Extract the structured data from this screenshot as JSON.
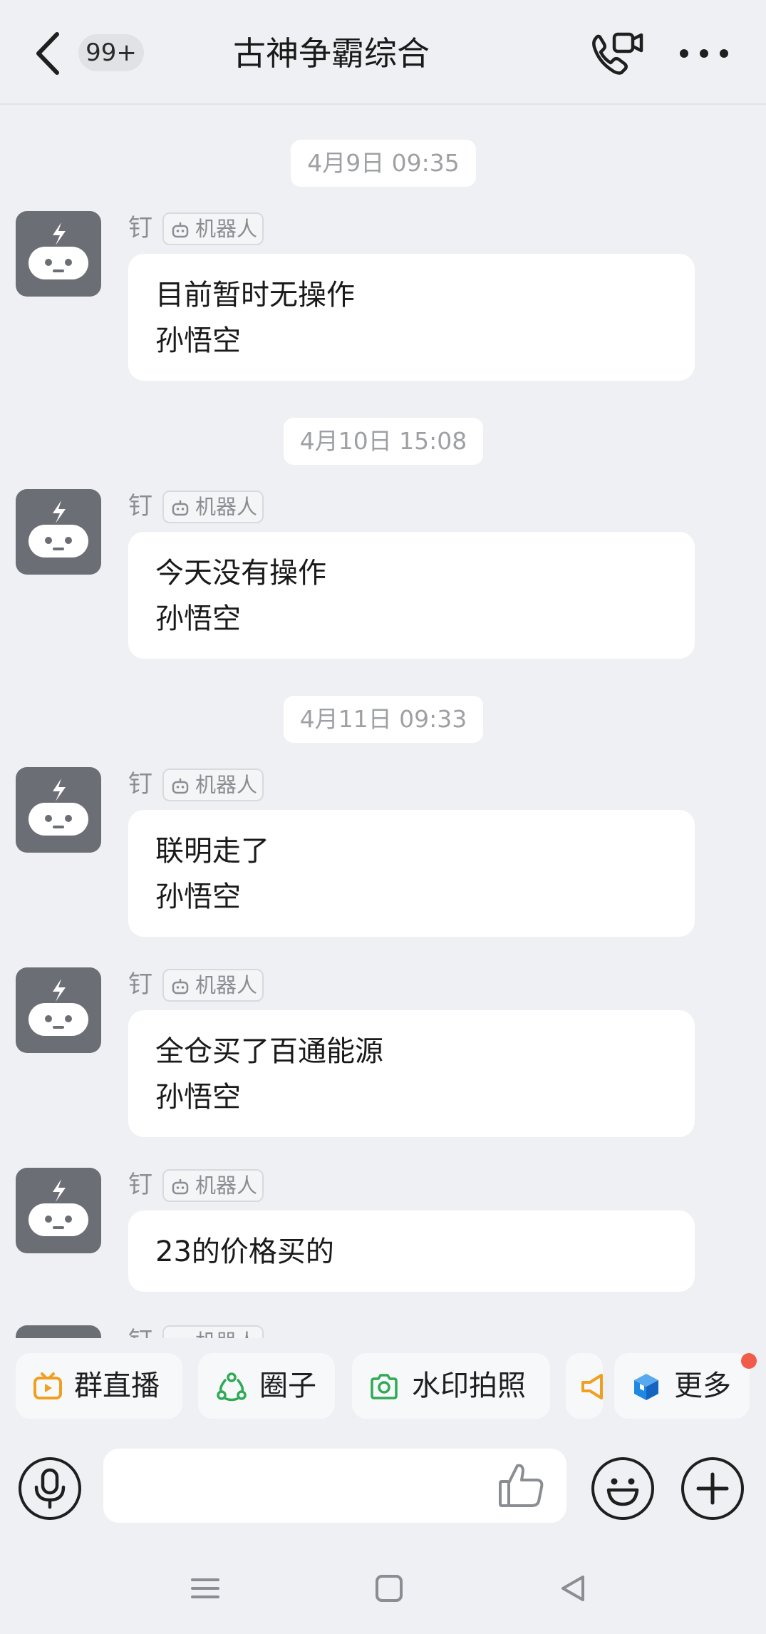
{
  "header": {
    "unread_badge": "99+",
    "title": "古神争霸综合",
    "icons": [
      "back-icon",
      "video-call-icon",
      "more-icon"
    ]
  },
  "messages": [
    {
      "timestamp": "4月9日 09:35",
      "sender": "钉",
      "tag": "机器人",
      "lines": [
        "目前暂时无操作",
        "孙悟空"
      ]
    },
    {
      "timestamp": "4月10日 15:08",
      "sender": "钉",
      "tag": "机器人",
      "lines": [
        "今天没有操作",
        "孙悟空"
      ]
    },
    {
      "timestamp": "4月11日 09:33",
      "sender": "钉",
      "tag": "机器人",
      "lines": [
        "联明走了",
        "孙悟空"
      ]
    },
    {
      "sender": "钉",
      "tag": "机器人",
      "lines": [
        "全仓买了百通能源",
        "孙悟空"
      ]
    },
    {
      "sender": "钉",
      "tag": "机器人",
      "lines": [
        "23的价格买的"
      ]
    },
    {
      "sender": "钉",
      "tag": "机器人",
      "lines": []
    }
  ],
  "quick_actions": [
    {
      "label": "群直播",
      "icon": "live-tv-icon",
      "color": "#f0a020"
    },
    {
      "label": "圈子",
      "icon": "circle-nodes-icon",
      "color": "#2faa55"
    },
    {
      "label": "水印拍照",
      "icon": "camera-icon",
      "color": "#2faa55"
    },
    {
      "label": "",
      "icon": "megaphone-icon",
      "color": "#f0a020"
    },
    {
      "label": "更多",
      "icon": "cube-icon",
      "color": "#1e88e5"
    }
  ],
  "more_has_notification": true,
  "input": {
    "value": "",
    "placeholder": ""
  },
  "colors": {
    "background": "#eef0f3",
    "bubble": "#ffffff",
    "avatar": "#6b6e74",
    "notify": "#f25a4a"
  }
}
